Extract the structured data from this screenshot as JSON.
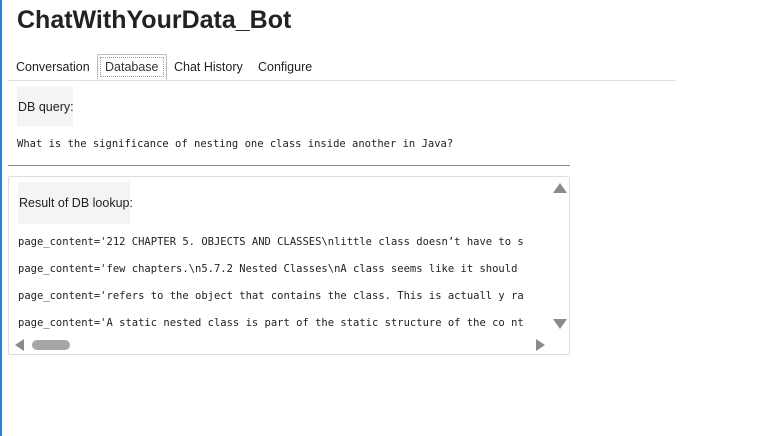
{
  "app": {
    "title": "ChatWithYourData_Bot"
  },
  "tabs": [
    {
      "label": "Conversation",
      "active": false
    },
    {
      "label": "Database",
      "active": true
    },
    {
      "label": "Chat History",
      "active": false
    },
    {
      "label": "Configure",
      "active": false
    }
  ],
  "db_query": {
    "label": "DB query:",
    "text": "What is the significance of nesting one class inside another in Java?"
  },
  "db_result": {
    "label": "Result of DB lookup:",
    "lines": [
      "page_content='212 CHAPTER 5. OBJECTS AND CLASSES\\nlittle class doesn’t have to s",
      "page_content='few chapters.\\n5.7.2 Nested Classes\\nA class seems like it should",
      "page_content='refers to the object that contains the class. This is actuall y ra",
      "page_content='A static nested class is part of the static structure of the co nt"
    ]
  },
  "colors": {
    "accent_edge": "#2a7fd9",
    "label_background": "#f4f4f4",
    "scrollbar": "#8a8a8a"
  }
}
